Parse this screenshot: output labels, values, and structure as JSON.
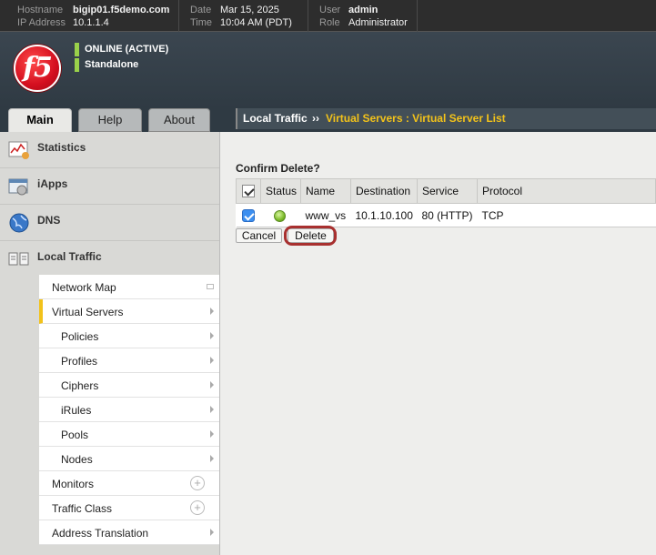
{
  "top_info": {
    "hostname_label": "Hostname",
    "hostname": "bigip01.f5demo.com",
    "ip_label": "IP Address",
    "ip": "10.1.1.4",
    "date_label": "Date",
    "date": "Mar 15, 2025",
    "time_label": "Time",
    "time": "10:04 AM (PDT)",
    "user_label": "User",
    "user": "admin",
    "role_label": "Role",
    "role": "Administrator"
  },
  "banner": {
    "logo_text": "f5",
    "status": "ONLINE (ACTIVE)",
    "mode": "Standalone",
    "status_color": "#9ad14a"
  },
  "tabs": [
    "Main",
    "Help",
    "About"
  ],
  "breadcrumb": {
    "section": "Local Traffic",
    "separator": "››",
    "path": "Virtual Servers : Virtual Server List"
  },
  "sidebar": {
    "sections": [
      "Statistics",
      "iApps",
      "DNS",
      "Local Traffic"
    ],
    "local_traffic_items": [
      "Network Map",
      "Virtual Servers",
      "Policies",
      "Profiles",
      "Ciphers",
      "iRules",
      "Pools",
      "Nodes",
      "Monitors",
      "Traffic Class",
      "Address Translation"
    ]
  },
  "main": {
    "confirm_title": "Confirm Delete?",
    "columns": [
      "Status",
      "Name",
      "Destination",
      "Service",
      "Protocol"
    ],
    "rows": [
      {
        "name": "www_vs",
        "destination": "10.1.10.100",
        "service": "80 (HTTP)",
        "protocol": "TCP"
      }
    ],
    "cancel_label": "Cancel",
    "delete_label": "Delete"
  },
  "colors": {
    "accent": "#f2c21a",
    "highlight_ring": "#a8302f",
    "brand_red": "#d40f1f"
  }
}
